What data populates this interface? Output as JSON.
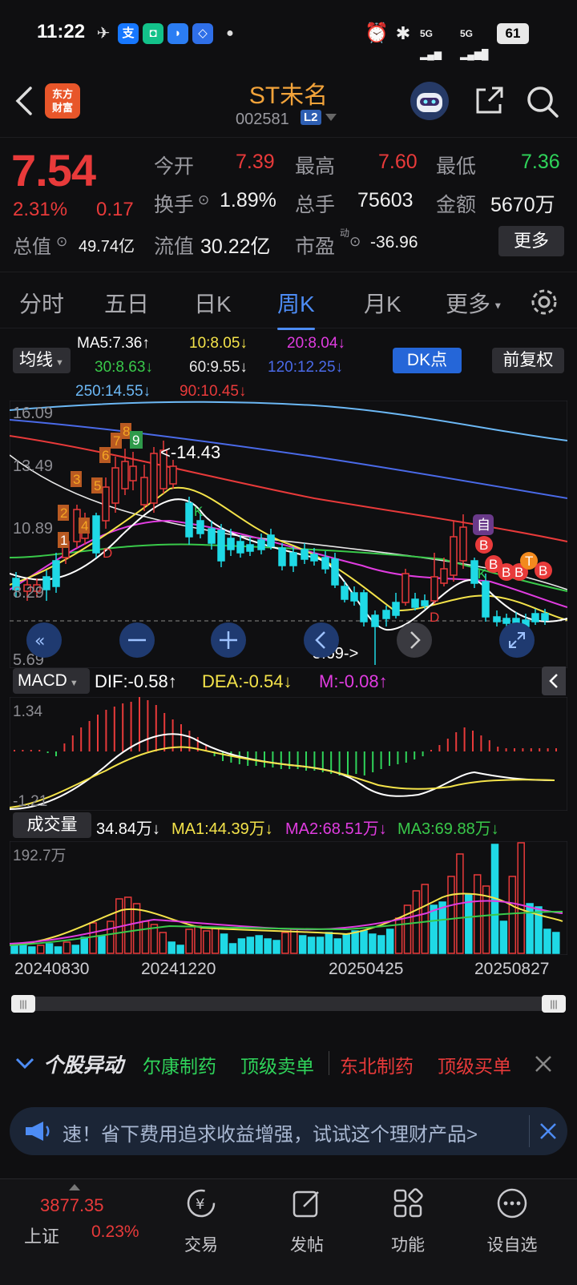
{
  "status_bar": {
    "time": "11:22",
    "battery": "61",
    "signal_1": "5G",
    "signal_2": "5G"
  },
  "header": {
    "title": "ST未名",
    "code": "002581",
    "level_badge": "L2",
    "logo_text_1": "东方",
    "logo_text_2": "财富"
  },
  "quote": {
    "price": "7.54",
    "change_pct": "2.31%",
    "change": "0.17",
    "open_label": "今开",
    "open": "7.39",
    "high_label": "最高",
    "high": "7.60",
    "low_label": "最低",
    "low": "7.36",
    "turnover_label": "换手",
    "turnover": "1.89%",
    "volume_label": "总手",
    "volume": "75603",
    "amount_label": "金额",
    "amount": "5670万",
    "mktcap_label": "总值",
    "mktcap": "49.74亿",
    "float_label": "流值",
    "float_cap": "30.22亿",
    "pe_label": "市盈",
    "pe_sup": "动",
    "pe": "-36.96",
    "more_button": "更多"
  },
  "tabs": [
    "分时",
    "五日",
    "日K",
    "周K",
    "月K",
    "更多"
  ],
  "active_tab": "周K",
  "ma_legend": {
    "ma5": "MA5:7.36↑",
    "ma10": "10:8.05↓",
    "ma20": "20:8.04↓",
    "ma30": "30:8.63↓",
    "ma60": "60:9.55↓",
    "ma120": "120:12.25↓",
    "ma250": "250:14.55↓",
    "ma90": "90:10.45↓"
  },
  "controls": {
    "ma_select": "均线",
    "dk_button": "DK点",
    "adjust_button": "前复权"
  },
  "price_axis": [
    "16.09",
    "13.49",
    "10.89",
    "8.29",
    "5.69"
  ],
  "annotations": {
    "high_mark": "<-14.43",
    "low_mark": "5.69->",
    "tag_zi": "自",
    "tag_b": "B",
    "tag_t": "T",
    "tag_d": "D",
    "tag_k": "K"
  },
  "td_count": [
    "1",
    "2",
    "3",
    "4",
    "5",
    "6",
    "7",
    "8",
    "9"
  ],
  "macd": {
    "select": "MACD",
    "dif": "DIF:-0.58↑",
    "dea": "DEA:-0.54↓",
    "m": "M:-0.08↑",
    "axis_top": "1.34",
    "axis_bottom": "-1.21"
  },
  "volume": {
    "select": "成交量",
    "value": "34.84万↓",
    "ma1": "MA1:44.39万↓",
    "ma2": "MA2:68.51万↓",
    "ma3": "MA3:69.88万↓",
    "axis_top": "192.7万"
  },
  "dates": [
    "20240830",
    "20241220",
    "20250425",
    "20250827"
  ],
  "movers": {
    "title": "个股异动",
    "items": [
      {
        "name": "尔康制药",
        "tag": "顶级卖单",
        "color": "#2fd35a"
      },
      {
        "name": "东北制药",
        "tag": "顶级买单",
        "color": "#e83a3a"
      }
    ]
  },
  "ad_banner": {
    "text": "速！省下费用追求收益增强，试试这个理财产品>"
  },
  "bottom_nav": {
    "index_value": "3877.35",
    "index_name": "上证",
    "index_change": "0.23%",
    "items": [
      "交易",
      "发帖",
      "功能",
      "设自选"
    ]
  },
  "colors": {
    "up": "#e83a3a",
    "down": "#2fd35a",
    "accent": "#4d8cf5",
    "title": "#f2a33a",
    "cyan": "#1fd9e6"
  }
}
